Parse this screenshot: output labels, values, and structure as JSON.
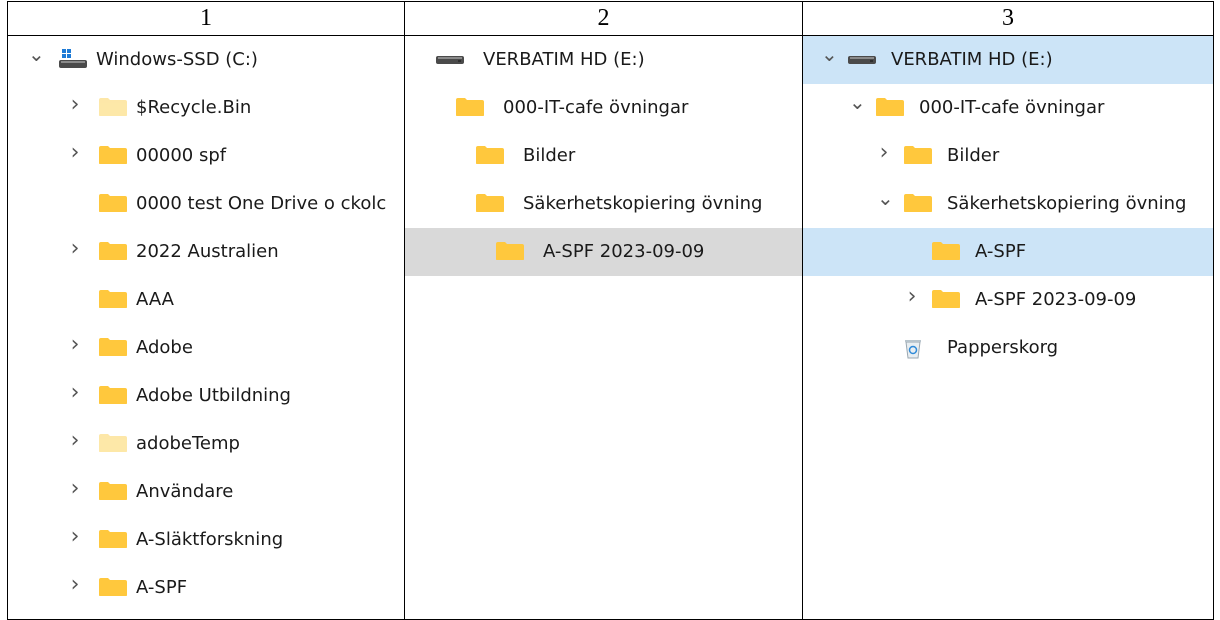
{
  "headers": [
    "1",
    "2",
    "3"
  ],
  "panes": [
    {
      "rows": [
        {
          "label": "Windows-SSD (C:)",
          "icon": "windows-drive-icon",
          "chevron": "down",
          "indent": 0
        },
        {
          "label": "$Recycle.Bin",
          "icon": "folder-light-icon",
          "chevron": "right",
          "indent": 1
        },
        {
          "label": "00000 spf",
          "icon": "folder-icon",
          "chevron": "right",
          "indent": 1
        },
        {
          "label": "0000 test One Drive o ckolc",
          "icon": "folder-icon",
          "chevron": "none",
          "indent": 1
        },
        {
          "label": "2022 Australien",
          "icon": "folder-icon",
          "chevron": "right",
          "indent": 1
        },
        {
          "label": "AAA",
          "icon": "folder-icon",
          "chevron": "none",
          "indent": 1
        },
        {
          "label": "Adobe",
          "icon": "folder-icon",
          "chevron": "right",
          "indent": 1
        },
        {
          "label": "Adobe Utbildning",
          "icon": "folder-icon",
          "chevron": "right",
          "indent": 1
        },
        {
          "label": "adobeTemp",
          "icon": "folder-light-icon",
          "chevron": "right",
          "indent": 1
        },
        {
          "label": "Användare",
          "icon": "folder-icon",
          "chevron": "right",
          "indent": 1
        },
        {
          "label": "A-Släktforskning",
          "icon": "folder-icon",
          "chevron": "right",
          "indent": 1
        },
        {
          "label": "A-SPF",
          "icon": "folder-icon",
          "chevron": "right",
          "indent": 1
        }
      ]
    },
    {
      "rows": [
        {
          "label": "VERBATIM HD (E:)",
          "icon": "drive-icon",
          "chevron": "none",
          "indent": 0
        },
        {
          "label": "000-IT-cafe övningar",
          "icon": "folder-icon",
          "chevron": "none",
          "indent": 1
        },
        {
          "label": "Bilder",
          "icon": "folder-icon",
          "chevron": "none",
          "indent": 2
        },
        {
          "label": "Säkerhetskopiering övning",
          "icon": "folder-icon",
          "chevron": "none",
          "indent": 2
        },
        {
          "label": "A-SPF 2023-09-09",
          "icon": "folder-icon",
          "chevron": "none",
          "indent": 3,
          "selected": "gray"
        }
      ]
    },
    {
      "rows": [
        {
          "label": "VERBATIM HD (E:)",
          "icon": "drive-icon",
          "chevron": "down",
          "indent": 0,
          "selected": "blue"
        },
        {
          "label": "000-IT-cafe övningar",
          "icon": "folder-icon",
          "chevron": "down",
          "indent": 1
        },
        {
          "label": "Bilder",
          "icon": "folder-icon",
          "chevron": "right",
          "indent": 2
        },
        {
          "label": "Säkerhetskopiering övning",
          "icon": "folder-icon",
          "chevron": "down",
          "indent": 2
        },
        {
          "label": "A-SPF",
          "icon": "folder-icon",
          "chevron": "none",
          "indent": 3,
          "selected": "blue"
        },
        {
          "label": "A-SPF 2023-09-09",
          "icon": "folder-icon",
          "chevron": "right",
          "indent": 3
        },
        {
          "label": "Papperskorg",
          "icon": "recycle-bin-icon",
          "chevron": "none",
          "indent": 2
        }
      ]
    }
  ],
  "colors": {
    "folder": "#ffc83d",
    "folder_light": "#fde7a8",
    "selected_gray": "#d9d9d9",
    "selected_blue": "#cce4f7"
  }
}
